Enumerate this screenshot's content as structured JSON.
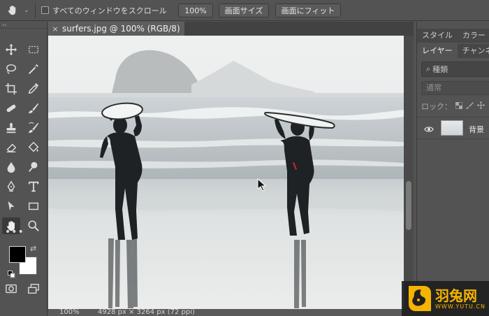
{
  "options_bar": {
    "tool_icon": "hand-icon",
    "scroll_all_windows_label": "すべてのウィンドウをスクロール",
    "zoom_100_label": "100%",
    "fit_screen_size_label": "画面サイズ",
    "fit_to_screen_label": "画面にフィット"
  },
  "tools_panel": {
    "collapse_label": "‹‹",
    "tools": [
      "move-icon",
      "marquee-icon",
      "lasso-icon",
      "magic-wand-icon",
      "crop-icon",
      "eyedropper-icon",
      "healing-icon",
      "brush-icon",
      "stamp-icon",
      "history-brush-icon",
      "eraser-icon",
      "paint-bucket-icon",
      "blur-icon",
      "dodge-icon",
      "pen-icon",
      "type-icon",
      "path-select-icon",
      "rectangle-icon",
      "hand-icon",
      "zoom-icon"
    ],
    "more_label": "•••",
    "foreground_color": "#000000",
    "background_color": "#ffffff"
  },
  "document": {
    "tab_label": "surfers.jpg @ 100% (RGB/8)",
    "close_label": "×",
    "status_zoom": "100%",
    "status_info": "4928 px × 3264 px (72 ppi)"
  },
  "right_panel": {
    "top_tabs": [
      "スタイル",
      "カラー"
    ],
    "layer_tabs": [
      "レイヤー",
      "チャンネル"
    ],
    "search_placeholder": "種類",
    "blend_mode": "通常",
    "lock_label": "ロック：",
    "layer_name": "背景"
  },
  "watermark": {
    "brand": "羽兔网",
    "url": "WWW.YUTU.CN",
    "color": "#f5b400"
  }
}
